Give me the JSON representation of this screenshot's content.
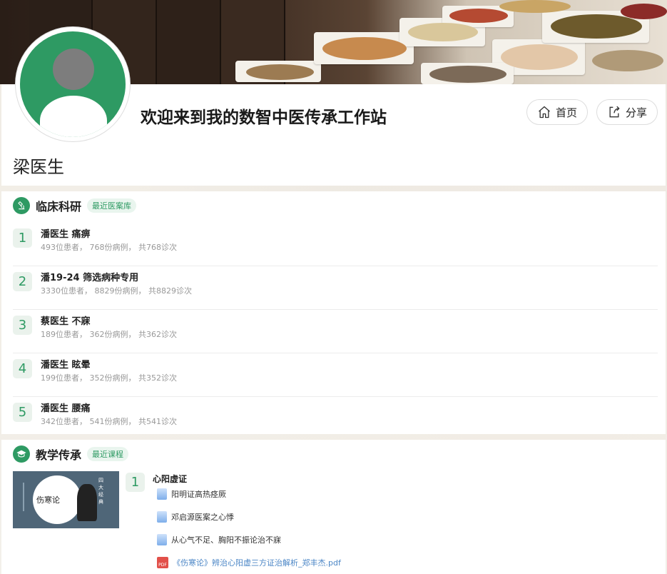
{
  "header": {
    "site_title": "欢迎来到我的数智中医传承工作站",
    "home_label": "首页",
    "share_label": "分享",
    "doctor_name": "梁医生"
  },
  "research": {
    "title": "临床科研",
    "tag": "最近医案库",
    "items": [
      {
        "rank": "1",
        "title": "潘医生 痛痹",
        "meta": "493位患者， 768份病例， 共768诊次"
      },
      {
        "rank": "2",
        "title": "潘19-24 筛选病种专用",
        "meta": "3330位患者， 8829份病例， 共8829诊次"
      },
      {
        "rank": "3",
        "title": "蔡医生 不寐",
        "meta": "189位患者， 362份病例， 共362诊次"
      },
      {
        "rank": "4",
        "title": "潘医生 眩晕",
        "meta": "199位患者， 352份病例， 共352诊次"
      },
      {
        "rank": "5",
        "title": "潘医生 腰痛",
        "meta": "342位患者， 541份病例， 共541诊次"
      }
    ]
  },
  "teaching": {
    "title": "教学传承",
    "tag": "最近课程",
    "course": {
      "rank": "1",
      "title": "心阳虚证",
      "thumb_text": "伤寒论",
      "thumb_vertical": "四大经典",
      "files": [
        {
          "name": "阳明证高热痉厥",
          "type": "doc"
        },
        {
          "name": "邓启源医案之心悸",
          "type": "doc"
        },
        {
          "name": "从心气不足、胸阳不振论治不寐",
          "type": "doc"
        },
        {
          "name": "《伤寒论》辨治心阳虚三方证治解析_郑丰杰.pdf",
          "type": "pdf"
        }
      ]
    }
  },
  "colors": {
    "accent": "#2e9a63",
    "rank_bg": "#eaf2ec",
    "link": "#4b86c6"
  },
  "icons": {
    "home": "home-icon",
    "share": "share-icon",
    "research": "microscope-icon",
    "teaching": "graduation-cap-icon"
  }
}
